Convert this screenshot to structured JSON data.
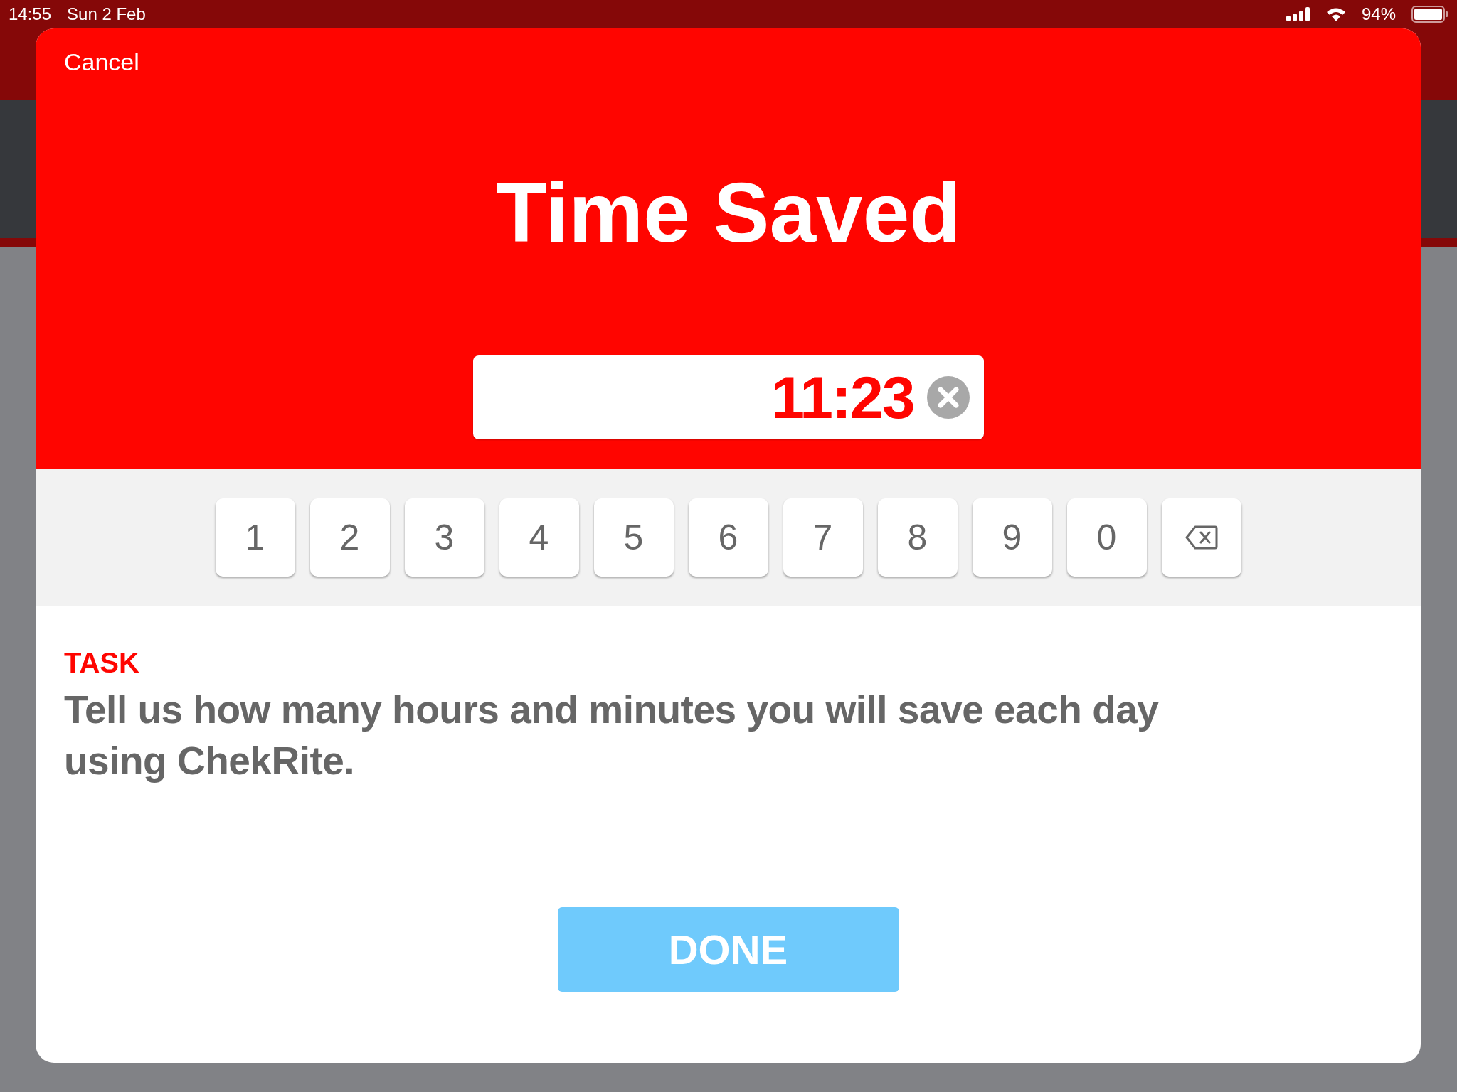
{
  "status_bar": {
    "time": "14:55",
    "date": "Sun 2 Feb",
    "battery": "94%"
  },
  "modal": {
    "cancel": "Cancel",
    "title": "Time Saved",
    "time_field": {
      "value": "11:23"
    },
    "keypad": [
      {
        "kind": "digit",
        "label": "1"
      },
      {
        "kind": "digit",
        "label": "2"
      },
      {
        "kind": "digit",
        "label": "3"
      },
      {
        "kind": "digit",
        "label": "4"
      },
      {
        "kind": "digit",
        "label": "5"
      },
      {
        "kind": "digit",
        "label": "6"
      },
      {
        "kind": "digit",
        "label": "7"
      },
      {
        "kind": "digit",
        "label": "8"
      },
      {
        "kind": "digit",
        "label": "9"
      },
      {
        "kind": "digit",
        "label": "0"
      },
      {
        "kind": "backspace"
      }
    ],
    "task": {
      "label": "TASK",
      "text": "Tell us how many hours and minutes you will save each day using ChekRite."
    },
    "done_button": "DONE"
  }
}
